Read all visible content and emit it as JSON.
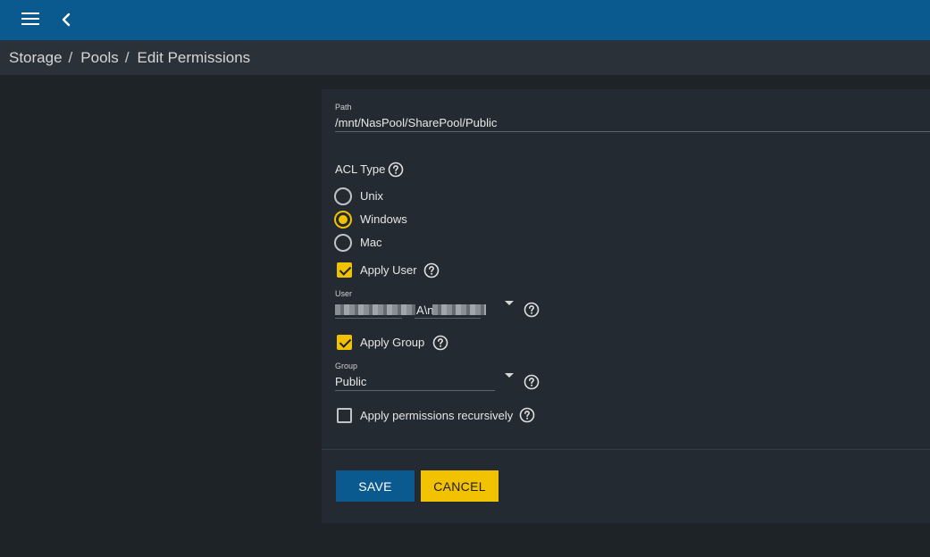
{
  "header": {
    "menu_icon": "hamburger-menu-icon",
    "back_icon": "chevron-left-icon",
    "color": "#0b5a8f"
  },
  "breadcrumb": [
    "Storage",
    "Pools",
    "Edit Permissions"
  ],
  "form": {
    "path": {
      "label": "Path",
      "value": "/mnt/NasPool/SharePool/Public"
    },
    "acl_type": {
      "label": "ACL Type",
      "options": [
        "Unix",
        "Windows",
        "Mac"
      ],
      "selected": "Windows"
    },
    "apply_user": {
      "label": "Apply User",
      "checked": true
    },
    "user": {
      "label": "User",
      "value": "A\\n"
    },
    "apply_group": {
      "label": "Apply Group",
      "checked": true
    },
    "group": {
      "label": "Group",
      "value": "Public"
    },
    "apply_recursive": {
      "label": "Apply permissions recursively",
      "checked": false
    }
  },
  "buttons": {
    "save": "SAVE",
    "cancel": "CANCEL"
  },
  "colors": {
    "accent": "#f2c200",
    "primary": "#0b5a8f",
    "card": "#232a31",
    "background": "#1e2328"
  }
}
